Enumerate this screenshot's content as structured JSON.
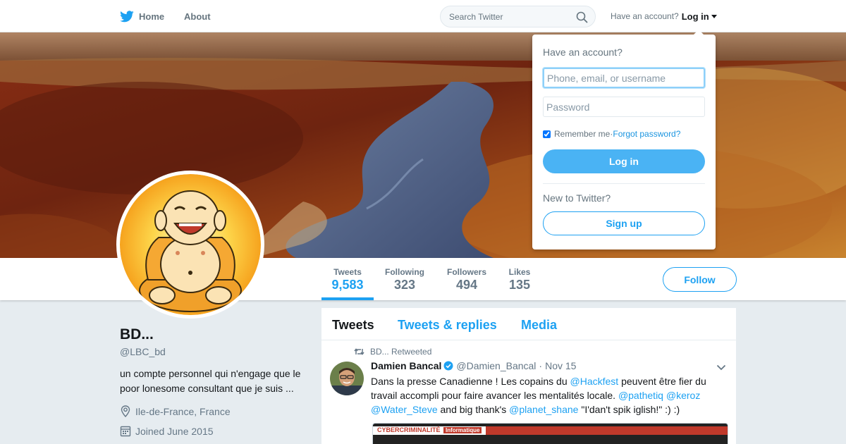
{
  "nav": {
    "home_label": "Home",
    "about_label": "About",
    "search_placeholder": "Search Twitter",
    "have_account": "Have an account?",
    "login_label": "Log in",
    "brand_color": "#1da1f2"
  },
  "profile": {
    "name": "BD...",
    "handle": "@LBC_bd",
    "bio_line1": "un compte personnel qui n'engage que le",
    "bio_line2": "poor lonesome consultant que je suis ...",
    "location": "Ile-de-France, France",
    "joined": "Joined June 2015",
    "stats": [
      {
        "label": "Tweets",
        "value": "9,583"
      },
      {
        "label": "Following",
        "value": "323"
      },
      {
        "label": "Followers",
        "value": "494"
      },
      {
        "label": "Likes",
        "value": "135"
      }
    ],
    "follow_label": "Follow"
  },
  "timeline": {
    "tabs": [
      "Tweets",
      "Tweets & replies",
      "Media"
    ],
    "tweet": {
      "retweeted_by": "BD... Retweeted",
      "author_name": "Damien Bancal",
      "author_handle": "@Damien_Bancal",
      "dot": "·",
      "time": "Nov 15",
      "text_1": "Dans la presse Canadienne ! Les copains du ",
      "mention_hackfest": "@Hackfest",
      "text_2": " peuvent être fier du travail accompli pour faire avancer les mentalités locale. ",
      "mention_pathetiq": "@pathetiq",
      "mention_keroz": "@keroz",
      "mention_water": "@Water_Steve",
      "text_3": " and big thank's ",
      "mention_planet": "@planet_shane",
      "text_4": " \"I'dan't spik iglish!\" :) :)",
      "media_caption_1": "CYBERCRIMINALITÉ",
      "media_caption_2": "Informatique"
    }
  },
  "login_dropdown": {
    "title": "Have an account?",
    "username_placeholder": "Phone, email, or username",
    "password_placeholder": "Password",
    "remember_label": "Remember me",
    "separator": " · ",
    "forgot_label": "Forgot password?",
    "login_button": "Log in",
    "new_label": "New to Twitter?",
    "signup_button": "Sign up"
  }
}
